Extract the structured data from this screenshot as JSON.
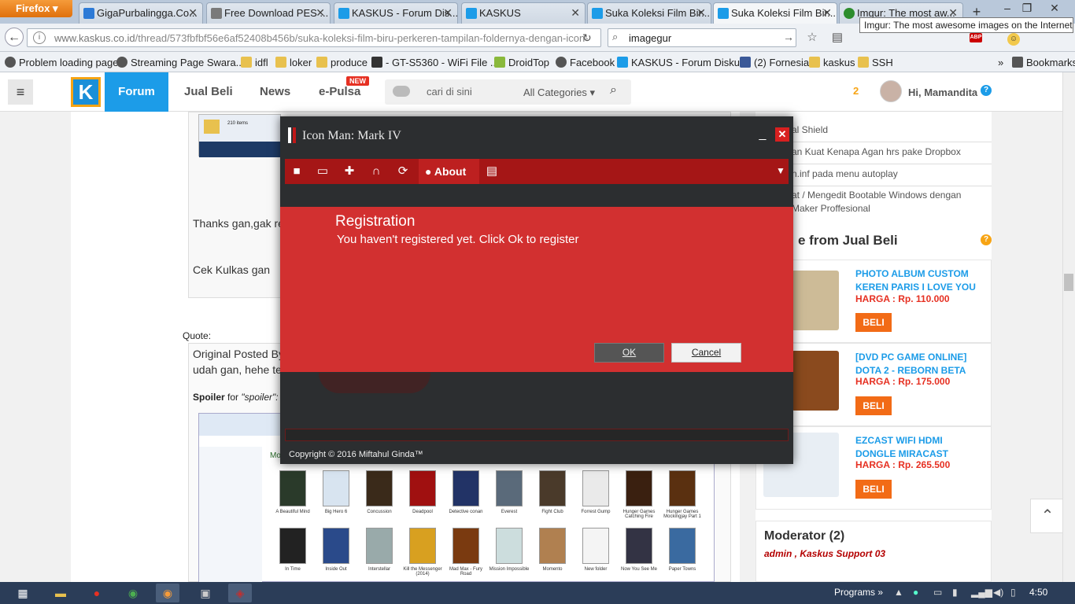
{
  "browser": {
    "firefox_label": "Firefox",
    "tabs": [
      {
        "label": "GigaPurbalingga.Co...",
        "color": "#2d7ad6"
      },
      {
        "label": "Free Download PES ...",
        "color": "#7a7a7a"
      },
      {
        "label": "KASKUS - Forum Dis...",
        "color": "#1c9ce8"
      },
      {
        "label": "KASKUS",
        "color": "#1c9ce8"
      },
      {
        "label": "Suka Koleksi Film Bir...",
        "color": "#1c9ce8"
      },
      {
        "label": "Suka Koleksi Film Bir...",
        "color": "#1c9ce8"
      },
      {
        "label": "Imgur: The most aw...",
        "color": "#2d8d2d"
      }
    ],
    "new_tab": "+",
    "tooltip": "Imgur: The most awesome images on the Internet",
    "url_host": "www.kaskus.co.id",
    "url_path": "/thread/573fbfbf56e6af52408b456b/suka-koleksi-film-biru-perkeren-tampilan-foldernya-dengan-icon-",
    "search_value": "imagegur",
    "bookmarks": [
      {
        "label": "Problem loading page",
        "icon": "globe-icon",
        "color": "#555"
      },
      {
        "label": "Streaming Page Swara...",
        "icon": "globe-icon",
        "color": "#555"
      },
      {
        "label": "idfl",
        "icon": "folder-icon",
        "color": "#e8c14e"
      },
      {
        "label": "loker",
        "icon": "folder-icon",
        "color": "#e8c14e"
      },
      {
        "label": "produce",
        "icon": "folder-icon",
        "color": "#e8c14e"
      },
      {
        "label": "- GT-S5360 - WiFi File ...",
        "icon": "wifi-icon",
        "color": "#333"
      },
      {
        "label": "DroidTop",
        "icon": "android-icon",
        "color": "#8ab93c"
      },
      {
        "label": "Facebook",
        "icon": "globe-icon",
        "color": "#555"
      },
      {
        "label": "KASKUS - Forum Disku...",
        "icon": "kaskus-icon",
        "color": "#1c9ce8"
      },
      {
        "label": "(2) Fornesia",
        "icon": "facebook-icon",
        "color": "#3b5998"
      },
      {
        "label": "kaskus",
        "icon": "folder-icon",
        "color": "#e8c14e"
      },
      {
        "label": "SSH",
        "icon": "folder-icon",
        "color": "#e8c14e"
      }
    ],
    "bookmarks_more": "»",
    "bookmarks_menu": "Bookmarks"
  },
  "kaskus": {
    "forum": "Forum",
    "jual_beli": "Jual Beli",
    "news": "News",
    "epulsa": "e-Pulsa",
    "new_badge": "NEW",
    "search_placeholder": "cari di sini",
    "category": "All Categories",
    "notif_count": "2",
    "greeting": "Hi, Mamandita",
    "post_text_1": "Thanks gan,gak re",
    "post_text_2": "Cek Kulkas gan",
    "quote_label": "Quote:",
    "original_posted": "Original Posted By",
    "quote_text": "udah gan, hehe te",
    "spoiler_label": "Spoiler",
    "spoiler_for": "for",
    "spoiler_name": "\"spoiler\":",
    "explorer_folder": "Mo",
    "explorer_items": "210 items",
    "movies": [
      "A Beautiful Mind",
      "Big Hero 6",
      "Concussion",
      "Deadpool",
      "Detective conan",
      "Everest",
      "Fight Club",
      "Forrest Gump",
      "Hunger Games Catching Fire",
      "Hunger Games Mockingjay Part 1",
      "In Time",
      "Inside Out",
      "Interstellar",
      "Kill the Messenger (2014)",
      "Mad Max - Fury Road",
      "Mission Impossible",
      "Momento",
      "New folder",
      "Now You See Me",
      "Paper Towns"
    ],
    "sidebar_links": [
      "al Shield",
      "an Kuat Kenapa Agan hrs pake Dropbox",
      "n.inf pada menu autoplay",
      "at / Mengedit Bootable Windows dengan",
      "Maker Proffesional"
    ],
    "jual_beli_title": "e from Jual Beli",
    "products": [
      {
        "title": "PHOTO ALBUM CUSTOM KEREN PARIS I LOVE YOU",
        "price": "HARGA : Rp. 110.000",
        "buy": "BELI"
      },
      {
        "title": "[DVD PC GAME ONLINE] DOTA 2 - REBORN BETA",
        "price": "HARGA : Rp. 175.000",
        "buy": "BELI"
      },
      {
        "title": "EZCAST WIFI HDMI DONGLE MIRACAST",
        "price": "HARGA : Rp. 265.500",
        "buy": "BELI"
      }
    ],
    "moderator_title": "Moderator (2)",
    "moderators": "admin , Kaskus Support 03"
  },
  "dialog": {
    "title": "Icon Man: Mark IV",
    "minimize": "_",
    "close": "✕",
    "about_tab": "About",
    "reg_title": "Registration",
    "reg_message": "You haven't registered yet. Click Ok to register",
    "ok": "OK",
    "cancel": "Cancel",
    "copyright": "Copyright © 2016 Miftahul Ginda™"
  },
  "taskbar": {
    "programs": "Programs",
    "clock": "4:50"
  }
}
